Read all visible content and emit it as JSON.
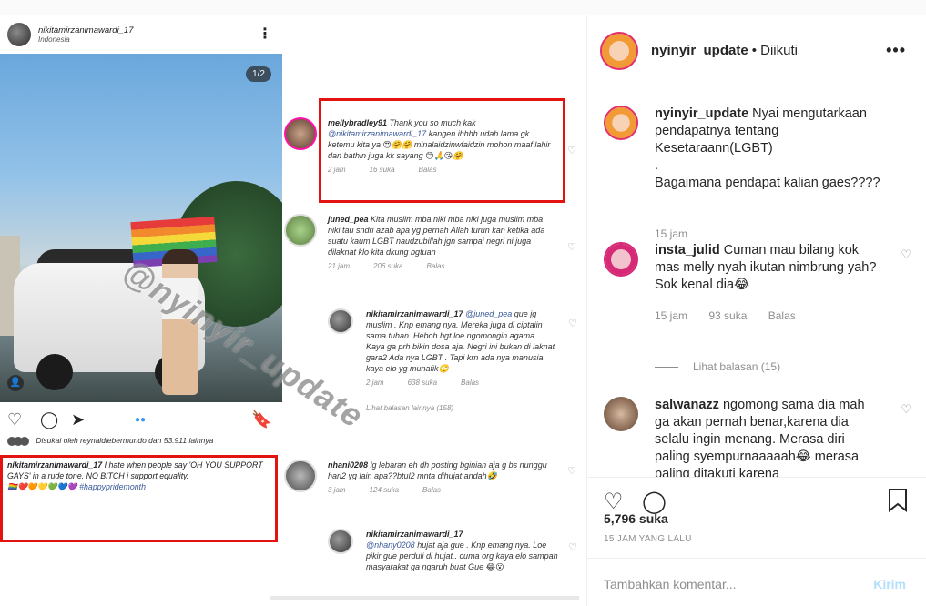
{
  "collage": {
    "author": "nikitamirzanimawardi_17",
    "location": "Indonesia",
    "counter": "1/2",
    "watermark": "@nyinyir_update",
    "liked_by": "Disukai oleh reynaldiebermundo dan 53.911 lainnya",
    "caption_user": "nikitamirzanimawardi_17",
    "caption_text": "I hate when people say 'OH YOU SUPPORT GAYS' in a rude tone. NO BITCH i support equality.",
    "caption_emojis": "🏳️‍🌈❤️🧡💛💚💙💜",
    "caption_hashtag": "#happypridemonth",
    "comments": [
      {
        "user": "mellybradley91",
        "text": "Thank you so much kak",
        "mention": "@nikitamirzanimawardi_17",
        "text2": "kangen ihhhh udah lama gk ketemu kita ya 😍🤗🤗 minalaidzinwfaidzin mohon maaf lahir dan bathin juga kk sayang 😊🙏😘🤗",
        "time": "2 jam",
        "likes": "16 suka",
        "reply": "Balas"
      },
      {
        "user": "juned_pea",
        "text": "Kita muslim mba niki mba niki juga muslim mba niki tau sndri azab apa yg pernah Allah turun kan ketika ada suatu kaum LGBT naudzubillah jgn sampai negri ni juga dilaknat klo kita dkung bgtuan",
        "time": "21 jam",
        "likes": "206 suka",
        "reply": "Balas"
      },
      {
        "user": "nikitamirzanimawardi_17",
        "mention": "@juned_pea",
        "text": "gue jg muslim . Knp emang nya. Mereka juga di ciptaiin sama tuhan. Heboh bgt loe ngomongin agama . Kaya ga prh bikin dosa aja. Negri ini bukan di laknat gara2 Ada nya LGBT . Tapi krn ada  nya manusia kaya elo yg munafik🙄",
        "time": "2 jam",
        "likes": "638 suka",
        "reply": "Balas",
        "more": "Lihat balasan lainnya (158)"
      },
      {
        "user": "nhani0208",
        "text": "lg lebaran eh dh posting bginian aja g bs nunggu hari2 yg lain apa??btul2 mnta dihujat andah🤣",
        "time": "3 jam",
        "likes": "124 suka",
        "reply": "Balas"
      },
      {
        "user": "nikitamirzanimawardi_17",
        "mention": "@nhany0208",
        "text": "hujat aja gue . Knp emang nya. Loe pikir gue perduli di hujat.. cuma org kaya elo sampah masyarakat ga ngaruh buat Gue 😂😮"
      }
    ]
  },
  "panel": {
    "header": {
      "username": "nyinyir_update",
      "follow": "• Diikuti",
      "more": "•••"
    },
    "comments": [
      {
        "user": "nyinyir_update",
        "text": "Nyai mengutarkaan pendapatnya tentang Kesetaraann(LGBT)\n.\nBagaimana pendapat kalian gaes????",
        "time": "15 jam"
      },
      {
        "user": "insta_julid",
        "text": "Cuman mau bilang kok mas melly nyah ikutan nimbrung yah? Sok kenal dia😂",
        "time": "15 jam",
        "likes": "93 suka",
        "reply": "Balas",
        "view_replies": "Lihat balasan (15)"
      },
      {
        "user": "salwanazz",
        "text": "ngomong sama dia mah ga akan pernah benar,karena dia selalu ingin menang. Merasa diri paling syempurnaaaaah😂 merasa paling ditakuti karena"
      }
    ],
    "likes": "5,796 suka",
    "time": "15 JAM YANG LALU",
    "add_comment_placeholder": "Tambahkan komentar...",
    "send": "Kirim"
  }
}
